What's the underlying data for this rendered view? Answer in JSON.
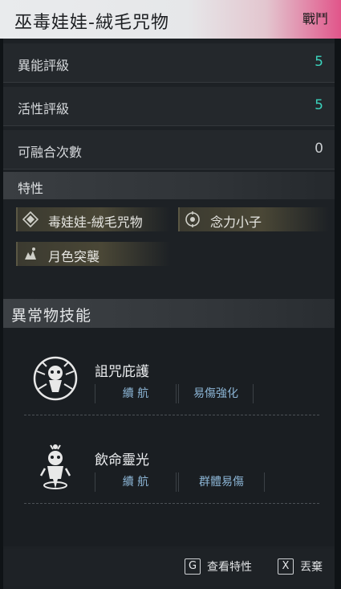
{
  "header": {
    "title": "巫毒娃娃-絨毛咒物",
    "type": "戰鬥"
  },
  "stats": [
    {
      "label": "異能評級",
      "value": "5",
      "color": "#3bd2bc"
    },
    {
      "label": "活性評級",
      "value": "5",
      "color": "#3bd2bc"
    },
    {
      "label": "可融合次數",
      "value": "0",
      "color": "#c9cccf"
    }
  ],
  "traits": {
    "title": "特性",
    "items": [
      {
        "label": "毒娃娃-絨毛咒物",
        "icon": "diamond-icon"
      },
      {
        "label": "念力小子",
        "icon": "target-icon"
      },
      {
        "label": "月色突襲",
        "icon": "moon-strike-icon"
      }
    ]
  },
  "skills": {
    "title": "異常物技能",
    "items": [
      {
        "name": "詛咒庇護",
        "tags": [
          "續 航",
          "易傷強化"
        ],
        "icon": "curse-shield-emblem-icon"
      },
      {
        "name": "飲命靈光",
        "tags": [
          "續 航",
          "群體易傷"
        ],
        "icon": "life-drain-emblem-icon"
      }
    ]
  },
  "footer": {
    "view_key": "G",
    "view_label": "查看特性",
    "discard_key": "X",
    "discard_label": "丟棄"
  },
  "colors": {
    "accent": "#3bd2bc",
    "header_pink": "#e1558a",
    "tag_text": "#8bb4d4"
  }
}
